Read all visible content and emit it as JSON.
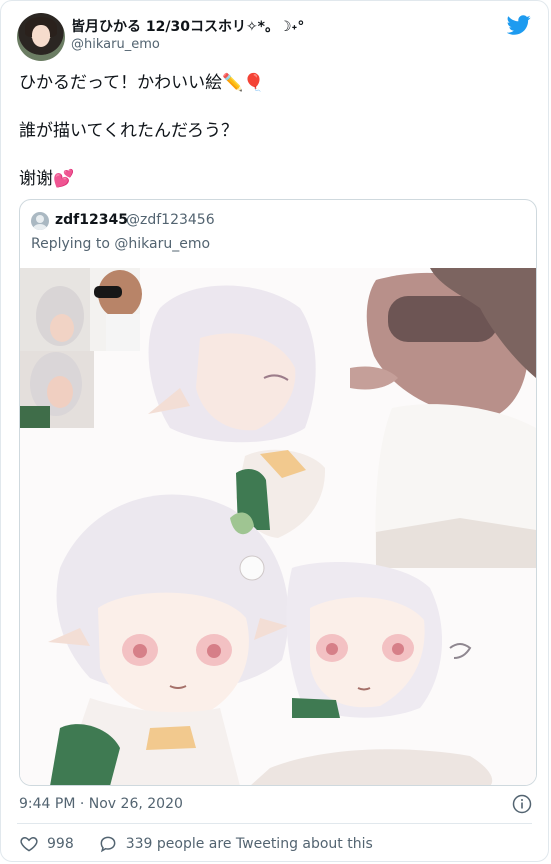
{
  "author": {
    "display_name": "皆月ひかる 12/30コスホリ✧*。☽˖°",
    "handle": "@hikaru_emo"
  },
  "tweet": {
    "line1": "ひかるだって！かわいい絵✏️🎈",
    "line2": "誰が描いてくれたんだろう？",
    "line3": "谢谢💕"
  },
  "quoted": {
    "name": "zdf12345",
    "handle": "@zdf123456",
    "reply_prefix": "Replying to",
    "reply_to": "@hikaru_emo"
  },
  "footer": {
    "timestamp": "9:44 PM · Nov 26, 2020",
    "likes": "998",
    "retweets_text": "339 people are Tweeting about this"
  },
  "colors": {
    "twitter_blue": "#1d9bf0",
    "secondary_text": "#536471",
    "border": "#cfd9de"
  }
}
